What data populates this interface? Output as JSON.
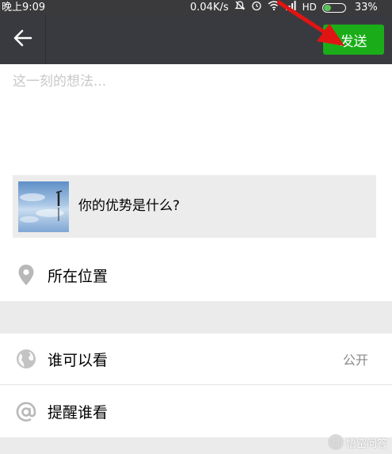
{
  "status_bar": {
    "time": "晚上9:09",
    "network_speed": "0.04K/s",
    "hd": "HD",
    "battery_percent": "33%",
    "battery_level": 0.33,
    "icons": [
      "mute-icon",
      "alarm-icon",
      "wifi-icon",
      "signal-icon",
      "battery-icon"
    ]
  },
  "top_bar": {
    "back_icon": "arrow-left-icon",
    "send_label": "发送",
    "send_color": "#1aad19"
  },
  "compose": {
    "placeholder": "这一刻的想法..."
  },
  "link_card": {
    "title": "你的优势是什么?"
  },
  "rows": {
    "location_label": "所在位置",
    "visibility_label": "谁可以看",
    "visibility_value": "公开",
    "mention_label": "提醒谁看"
  },
  "watermark": {
    "text": "悟空问答"
  }
}
